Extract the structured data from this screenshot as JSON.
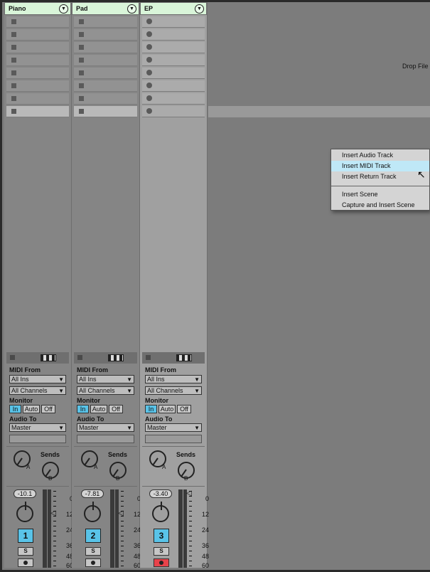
{
  "tracks": [
    {
      "name": "Piano",
      "slot_type": "stop",
      "midi_from_label": "MIDI From",
      "midi_from": "All Ins",
      "channel": "All Channels",
      "monitor_label": "Monitor",
      "monitor": [
        "In",
        "Auto",
        "Off"
      ],
      "audio_to_label": "Audio To",
      "audio_to": "Master",
      "sends_label": "Sends",
      "send_a": "A",
      "send_b": "B",
      "volume": "-10.1",
      "number": "1",
      "solo": "S",
      "armed": false
    },
    {
      "name": "Pad",
      "slot_type": "stop",
      "midi_from_label": "MIDI From",
      "midi_from": "All Ins",
      "channel": "All Channels",
      "monitor_label": "Monitor",
      "monitor": [
        "In",
        "Auto",
        "Off"
      ],
      "audio_to_label": "Audio To",
      "audio_to": "Master",
      "sends_label": "Sends",
      "send_a": "A",
      "send_b": "B",
      "volume": "-7.81",
      "number": "2",
      "solo": "S",
      "armed": false
    },
    {
      "name": "EP",
      "slot_type": "record",
      "midi_from_label": "MIDI From",
      "midi_from": "All Ins",
      "channel": "All Channels",
      "monitor_label": "Monitor",
      "monitor": [
        "In",
        "Auto",
        "Off"
      ],
      "audio_to_label": "Audio To",
      "audio_to": "Master",
      "sends_label": "Sends",
      "send_a": "A",
      "send_b": "B",
      "volume": "-3.40",
      "number": "3",
      "solo": "S",
      "armed": true
    }
  ],
  "meter_scale": [
    "0",
    "12",
    "24",
    "36",
    "48",
    "60"
  ],
  "drop_hint": "Drop File",
  "context_menu": {
    "items": [
      "Insert Audio Track",
      "Insert MIDI Track",
      "Insert Return Track",
      "Insert Scene",
      "Capture and Insert Scene"
    ],
    "highlighted": "Insert MIDI Track"
  },
  "colors": {
    "header": "#d9f5d9",
    "accent": "#59c3e8",
    "arm": "#e8424a"
  }
}
